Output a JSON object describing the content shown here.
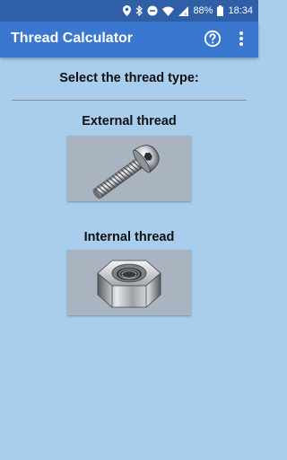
{
  "status_bar": {
    "battery_percent": "88%",
    "time": "18:34"
  },
  "app_bar": {
    "title": "Thread Calculator"
  },
  "main": {
    "heading": "Select the thread type:",
    "options": [
      {
        "label": "External thread",
        "icon": "bolt-icon"
      },
      {
        "label": "Internal thread",
        "icon": "nut-icon"
      }
    ]
  },
  "colors": {
    "status_bar": "#2f5fa6",
    "app_bar": "#3a77cf",
    "background": "#a9cdec",
    "tile": "#a9b4c0"
  }
}
